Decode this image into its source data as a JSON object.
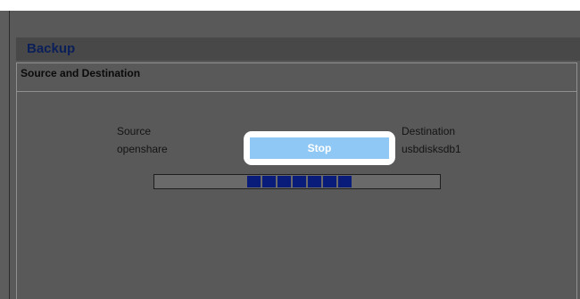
{
  "app": {
    "title": "Backup"
  },
  "section": {
    "title": "Source and Destination"
  },
  "source": {
    "label": "Source",
    "value": "openshare"
  },
  "destination": {
    "label": "Destination",
    "value": "usbdisksdb1"
  },
  "stop_button": {
    "label": "Stop"
  },
  "progress": {
    "style": "indeterminate-marquee",
    "segment_count": 7,
    "segment_color": "#0a1c7a"
  },
  "colors": {
    "title_text": "#0b1f59",
    "button_fill": "#8fc8f5",
    "overlay_background": "#5d5d5d"
  }
}
